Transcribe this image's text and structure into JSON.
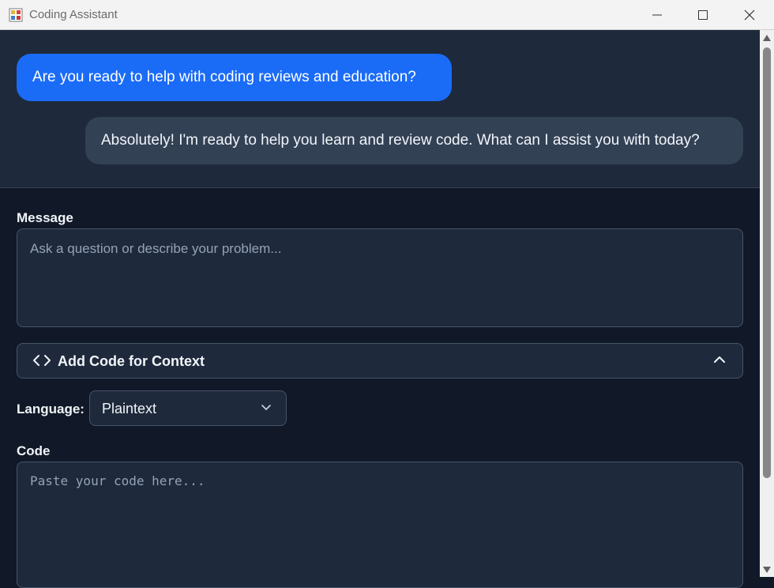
{
  "window": {
    "title": "Coding Assistant",
    "icons": {
      "app": "app-icon",
      "minimize": "minimize-icon",
      "maximize": "maximize-icon",
      "close": "close-icon"
    }
  },
  "chat": {
    "messages": [
      {
        "role": "user",
        "text": "Are you ready to help with coding reviews and education?"
      },
      {
        "role": "assistant",
        "text": "Absolutely! I'm ready to help you learn and review code. What can I assist you with today?"
      }
    ]
  },
  "compose": {
    "message_label": "Message",
    "message_placeholder": "Ask a question or describe your problem...",
    "code_toggle_label": "Add Code for Context",
    "language_label": "Language:",
    "language_value": "Plaintext",
    "code_label": "Code",
    "code_placeholder": "Paste your code here..."
  },
  "colors": {
    "user_bubble": "#1a6cf7",
    "assistant_bubble": "#334155",
    "chat_bg": "#1e293b",
    "page_bg": "#111827"
  }
}
